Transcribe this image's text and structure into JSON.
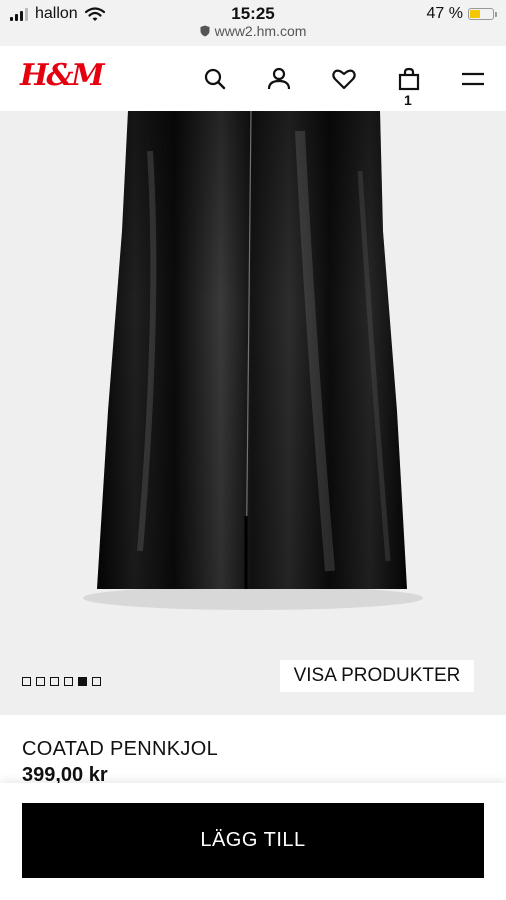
{
  "status_bar": {
    "carrier": "hallon",
    "time": "15:25",
    "url": "www2.hm.com",
    "battery": "47 %",
    "battery_level": 0.47
  },
  "header": {
    "logo": "H&M",
    "bag_count": "1",
    "icons": [
      "search-icon",
      "account-icon",
      "heart-icon",
      "shopping-bag-icon",
      "menu-icon"
    ]
  },
  "gallery": {
    "image_count": 6,
    "active_index": 4,
    "visa_produkter_label": "VISA PRODUKTER"
  },
  "product": {
    "name": "COATAD PENNKJOL",
    "price": "399,00 kr"
  },
  "actions": {
    "add_label": "LÄGG TILL"
  },
  "colors": {
    "brand": "#e50010",
    "button": "#000000",
    "battery": "#f4c700"
  }
}
